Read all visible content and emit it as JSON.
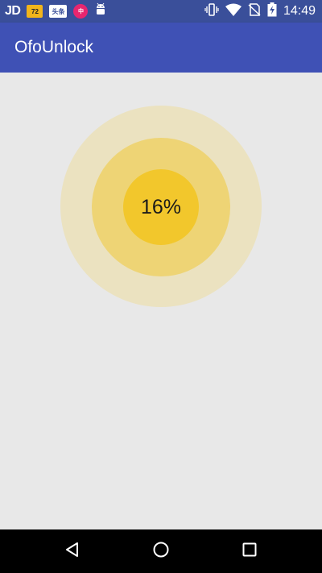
{
  "status_bar": {
    "left_text": "JD",
    "notif_72": "72",
    "notif_toutiao": "头条",
    "notif_zhongdou": "中",
    "time": "14:49"
  },
  "app_bar": {
    "title": "OfoUnlock"
  },
  "progress": {
    "label": "16%",
    "value": 0.16
  },
  "colors": {
    "app_bar": "#3f51b5",
    "status_bar": "#3a4f9a",
    "ring_outer": "#ebe2c0",
    "ring_middle": "#eed475",
    "ring_inner": "#f2c72c",
    "background": "#e8e8e8"
  },
  "icons": [
    "android-icon",
    "vibrate-icon",
    "wifi-icon",
    "no-sim-icon",
    "battery-charging-icon",
    "back-icon",
    "home-icon",
    "recents-icon"
  ]
}
